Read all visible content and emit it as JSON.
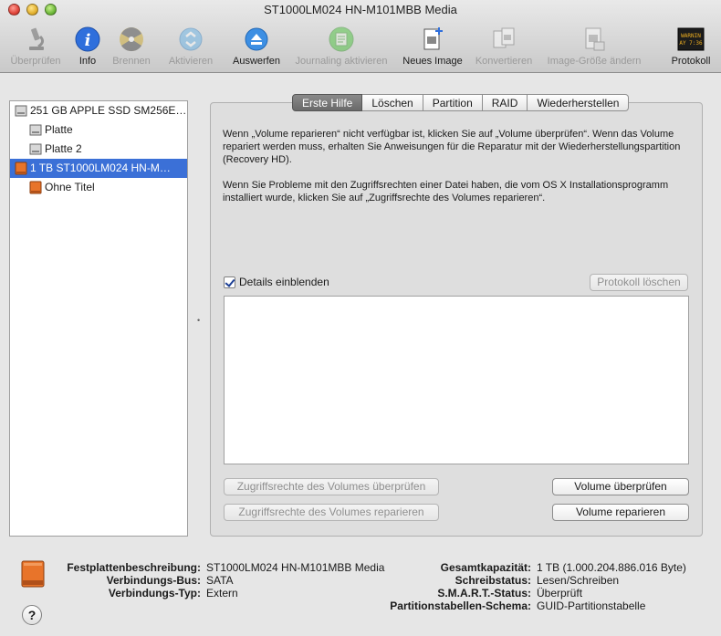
{
  "window": {
    "title": "ST1000LM024 HN-M101MBB Media"
  },
  "toolbar": {
    "items": [
      {
        "label": "Überprüfen",
        "icon": "microscope-icon",
        "enabled": false
      },
      {
        "label": "Info",
        "icon": "info-icon",
        "enabled": true
      },
      {
        "label": "Brennen",
        "icon": "burn-icon",
        "enabled": false
      },
      {
        "label": "Aktivieren",
        "icon": "activate-icon",
        "enabled": false
      },
      {
        "label": "Auswerfen",
        "icon": "eject-icon",
        "enabled": true
      },
      {
        "label": "Journaling aktivieren",
        "icon": "journaling-icon",
        "enabled": false
      },
      {
        "label": "Neues Image",
        "icon": "new-image-icon",
        "enabled": true
      },
      {
        "label": "Konvertieren",
        "icon": "convert-icon",
        "enabled": false
      },
      {
        "label": "Image-Größe ändern",
        "icon": "resize-image-icon",
        "enabled": false
      },
      {
        "label": "Protokoll",
        "icon": "log-icon",
        "enabled": true,
        "icon_text": "WARNIN\nAY 7:36"
      }
    ]
  },
  "sidebar": {
    "items": [
      {
        "label": "251 GB APPLE SSD SM256E…",
        "level": 0,
        "selected": false,
        "icon": "internal-disk-icon"
      },
      {
        "label": "Platte",
        "level": 1,
        "selected": false,
        "icon": "volume-icon"
      },
      {
        "label": "Platte 2",
        "level": 1,
        "selected": false,
        "icon": "volume-icon"
      },
      {
        "label": "1 TB ST1000LM024 HN-M…",
        "level": 0,
        "selected": true,
        "icon": "external-disk-icon"
      },
      {
        "label": "Ohne Titel",
        "level": 1,
        "selected": false,
        "icon": "external-volume-icon"
      }
    ]
  },
  "tabs": [
    "Erste Hilfe",
    "Löschen",
    "Partition",
    "RAID",
    "Wiederherstellen"
  ],
  "first_aid": {
    "paragraph1": "Wenn „Volume reparieren“ nicht verfügbar ist, klicken Sie auf „Volume überprüfen“. Wenn das Volume repariert werden muss, erhalten Sie Anweisungen für die Reparatur mit der Wiederherstellungspartition (Recovery HD).",
    "paragraph2": "Wenn Sie Probleme mit den Zugriffsrechten einer Datei haben, die vom OS X Installationsprogramm installiert wurde, klicken Sie auf „Zugriffsrechte des Volumes reparieren“.",
    "show_details_label": "Details einblenden",
    "show_details_checked": true,
    "clear_log_label": "Protokoll löschen",
    "verify_permissions_label": "Zugriffsrechte des Volumes überprüfen",
    "repair_permissions_label": "Zugriffsrechte des Volumes reparieren",
    "verify_volume_label": "Volume überprüfen",
    "repair_volume_label": "Volume reparieren"
  },
  "disk_info": {
    "left": [
      {
        "key": "Festplattenbeschreibung:",
        "value": "ST1000LM024 HN-M101MBB Media"
      },
      {
        "key": "Verbindungs-Bus:",
        "value": "SATA"
      },
      {
        "key": "Verbindungs-Typ:",
        "value": "Extern"
      }
    ],
    "right": [
      {
        "key": "Gesamtkapazität:",
        "value": "1 TB (1.000.204.886.016 Byte)"
      },
      {
        "key": "Schreibstatus:",
        "value": "Lesen/Schreiben"
      },
      {
        "key": "S.M.A.R.T.-Status:",
        "value": "Überprüft"
      },
      {
        "key": "Partitionstabellen-Schema:",
        "value": "GUID-Partitionstabelle"
      }
    ]
  },
  "help_label": "?",
  "colors": {
    "selection": "#3b70d7",
    "external_disk": "#e8742a"
  }
}
